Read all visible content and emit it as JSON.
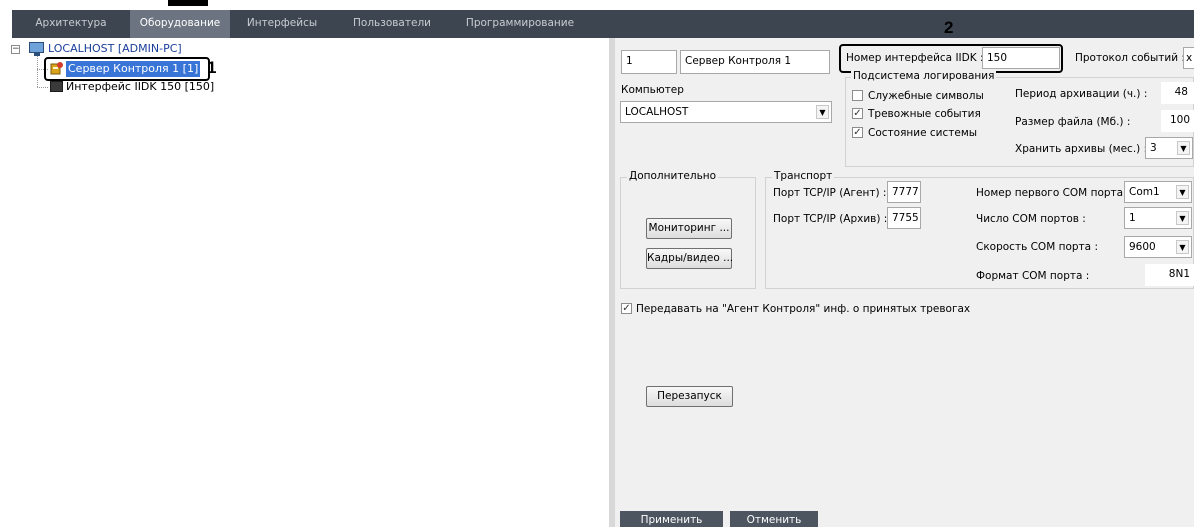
{
  "tabs": [
    {
      "label": "Архитектура",
      "active": false
    },
    {
      "label": "Оборудование",
      "active": true
    },
    {
      "label": "Интерфейсы",
      "active": false
    },
    {
      "label": "Пользователи",
      "active": false
    },
    {
      "label": "Программирование",
      "active": false
    }
  ],
  "tree": {
    "root_label": "LOCALHOST [ADMIN-PC]",
    "items": [
      {
        "label": "Сервер Контроля 1 [1]",
        "selected": true
      },
      {
        "label": "Интерфейс IIDK 150 [150]",
        "selected": false
      }
    ]
  },
  "annotations": {
    "one": "1",
    "two": "2"
  },
  "form": {
    "id_value": "1",
    "name_value": "Сервер Контроля 1",
    "computer_label": "Компьютер",
    "computer_value": "LOCALHOST",
    "iidk_label": "Номер интерфейса IIDK :",
    "iidk_value": "150",
    "protocol_label": "Протокол событий :",
    "protocol_button": "x",
    "logging_title": "Подсистема логирования",
    "chk_service": {
      "label": "Служебные символы",
      "checked": false
    },
    "chk_alarm": {
      "label": "Тревожные события",
      "checked": true
    },
    "chk_state": {
      "label": "Состояние системы",
      "checked": true
    },
    "archive_period_label": "Период архивации (ч.) :",
    "archive_period_value": "48",
    "file_size_label": "Размер файла (Мб.) :",
    "file_size_value": "100",
    "keep_archives_label": "Хранить архивы (мес.) :",
    "keep_archives_value": "3",
    "additional_title": "Дополнительно",
    "monitoring_button": "Мониторинг ...",
    "frames_button": "Кадры/видео ...",
    "transport_title": "Транспорт",
    "port_agent_label": "Порт TCP/IP (Агент) :",
    "port_agent_value": "7777",
    "port_archive_label": "Порт TCP/IP (Архив) :",
    "port_archive_value": "7755",
    "com_first_label": "Номер первого COM порта :",
    "com_first_value": "Com1",
    "com_count_label": "Число COM портов :",
    "com_count_value": "1",
    "com_speed_label": "Скорость COM порта :",
    "com_speed_value": "9600",
    "com_format_label": "Формат COM порта :",
    "com_format_value": "8N1",
    "transmit_label": "Передавать на \"Агент Контроля\" инф. о принятых тревогах",
    "transmit_checked": true,
    "restart_button": "Перезапуск",
    "apply_button": "Применить",
    "cancel_button": "Отменить"
  },
  "check_glyph": "✓",
  "dropdown_glyph": "▼",
  "expander_glyph": "−"
}
